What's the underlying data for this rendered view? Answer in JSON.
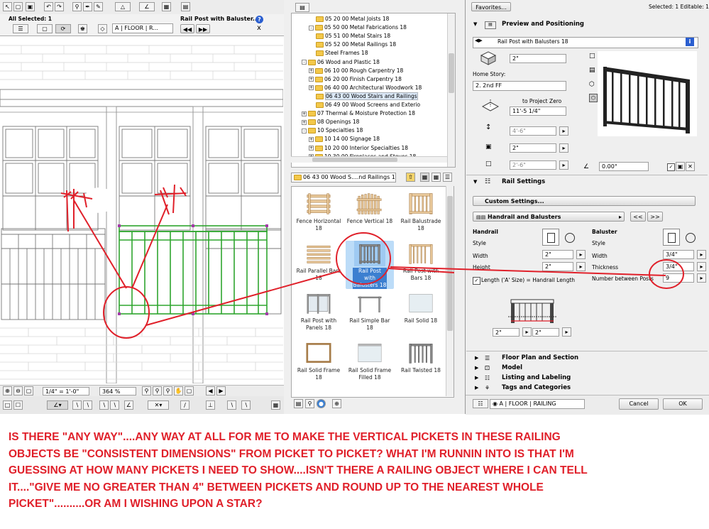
{
  "left_toolbar": {
    "selection_info": "All Selected: 1",
    "layer_value": "A | FLOOR | R...",
    "object_title": "Rail Post with Baluster...",
    "help": "?",
    "close": "x"
  },
  "left_status": {
    "scale": "1/4\" = 1'-0\"",
    "zoom": "364 %"
  },
  "library_tree": {
    "rows": [
      {
        "indent": 3,
        "label": "05 20 00 Metal Joists 18",
        "folder": true
      },
      {
        "indent": 2,
        "label": "05 50 00 Metal Fabrications 18",
        "folder": true,
        "toggle": "-"
      },
      {
        "indent": 3,
        "label": "05 51 00 Metal Stairs 18",
        "folder": true
      },
      {
        "indent": 3,
        "label": "05 52 00 Metal Railings 18",
        "folder": true
      },
      {
        "indent": 3,
        "label": "Steel Frames 18",
        "folder": true
      },
      {
        "indent": 1,
        "label": "06 Wood and Plastic 18",
        "folder": true,
        "toggle": "-"
      },
      {
        "indent": 2,
        "label": "06 10 00 Rough Carpentry 18",
        "folder": true,
        "toggle": "+"
      },
      {
        "indent": 2,
        "label": "06 20 00 Finish Carpentry 18",
        "folder": true,
        "toggle": "+"
      },
      {
        "indent": 2,
        "label": "06 40 00 Architectural Woodwork 18",
        "folder": true,
        "toggle": "+"
      },
      {
        "indent": 3,
        "label": "06 43 00 Wood Stairs and Railings",
        "folder": true,
        "selected": true
      },
      {
        "indent": 3,
        "label": "06 49 00 Wood Screens and Exterio",
        "folder": true
      },
      {
        "indent": 1,
        "label": "07 Thermal & Moisture Protection 18",
        "folder": true,
        "toggle": "+"
      },
      {
        "indent": 1,
        "label": "08 Openings 18",
        "folder": true,
        "toggle": "+"
      },
      {
        "indent": 1,
        "label": "10 Specialties 18",
        "folder": true,
        "toggle": "-"
      },
      {
        "indent": 2,
        "label": "10 14 00 Signage 18",
        "folder": true,
        "toggle": "+"
      },
      {
        "indent": 2,
        "label": "10 20 00 Interior Specialties 18",
        "folder": true,
        "toggle": "+"
      },
      {
        "indent": 2,
        "label": "10 30 00 Fireplaces and Stoves 18",
        "folder": true,
        "toggle": "+"
      }
    ]
  },
  "library_path": "06 43 00 Wood S....nd Railings 18",
  "library_items": [
    {
      "label": "Fence Horizontal 18",
      "thumb": "fence-horizontal"
    },
    {
      "label": "Fence Vertical 18",
      "thumb": "fence-vertical"
    },
    {
      "label": "Rail Balustrade 18",
      "thumb": "rail-balustrade"
    },
    {
      "label": "Rail Parallel Bars 18",
      "thumb": "rail-parallel"
    },
    {
      "label": "Rail Post with Balusters 18",
      "thumb": "rail-post-balusters",
      "selected": true
    },
    {
      "label": "Rail Post with Bars 18",
      "thumb": "rail-post-bars"
    },
    {
      "label": "Rail Post with Panels 18",
      "thumb": "rail-post-panels"
    },
    {
      "label": "Rail Simple Bar 18",
      "thumb": "rail-simple-bar"
    },
    {
      "label": "Rail Solid 18",
      "thumb": "rail-solid"
    },
    {
      "label": "Rail Solid Frame 18",
      "thumb": "rail-solid-frame"
    },
    {
      "label": "Rail Solid Frame Filled 18",
      "thumb": "rail-solid-frame-filled"
    },
    {
      "label": "Rail Twisted 18",
      "thumb": "rail-twisted"
    }
  ],
  "settings": {
    "favorites": "Favorites...",
    "selected_info": "Selected: 1 Editable: 1",
    "preview_title": "Preview and Positioning",
    "object_name": "Rail Post with Balusters 18",
    "elevation": "2\"",
    "home_story_label": "Home Story:",
    "home_story_value": "2. 2nd FF",
    "to_project_zero": "to Project Zero",
    "project_zero_value": "11'-5 1/4\"",
    "dim_a": "4'-6\"",
    "dim_b": "2\"",
    "dim_c": "2'-6\"",
    "angle": "0.00°",
    "rail_settings_title": "Rail Settings",
    "custom_settings": "Custom Settings...",
    "page_select": "Handrail and Balusters",
    "prev": "<<",
    "next": ">>",
    "handrail": {
      "header": "Handrail",
      "style": "Style",
      "width_label": "Width",
      "width": "2\"",
      "height_label": "Height",
      "height": "2\""
    },
    "baluster": {
      "header": "Baluster",
      "style": "Style",
      "width_label": "Width",
      "width": "3/4\"",
      "thickness_label": "Thickness",
      "thickness": "3/4\"",
      "num_label": "Number between Posts",
      "num": "9"
    },
    "length_checkbox": "Length ('A' Size) = Handrail Length",
    "diagram_left": "2\"",
    "diagram_right": "2\"",
    "sections": [
      "Floor Plan and Section",
      "Model",
      "Listing and Labeling",
      "Tags and Categories"
    ],
    "layer_value": "A | FLOOR | RAILING",
    "cancel": "Cancel",
    "ok": "OK"
  },
  "question": [
    "IS THERE \"ANY WAY\"....ANY WAY AT ALL FOR ME TO MAKE THE VERTICAL PICKETS IN THESE RAILING",
    "OBJECTS BE \"CONSISTENT DIMENSIONS\" FROM PICKET TO PICKET? WHAT I'M RUNNIN INTO IS THAT I'M",
    "GUESSING AT HOW MANY PICKETS I NEED TO SHOW....ISN'T THERE A RAILING OBJECT WHERE I CAN TELL",
    "IT....\"GIVE ME NO GREATER THAN 4\" BETWEEN PICKETS AND ROUND UP TO THE NEAREST WHOLE",
    "PICKET\"..........OR AM I WISHING UPON A STAR?"
  ],
  "colors": {
    "annotation_red": "#e0202a",
    "selection_green": "#2ea52e",
    "selection_highlight": "#8fc2f2"
  }
}
